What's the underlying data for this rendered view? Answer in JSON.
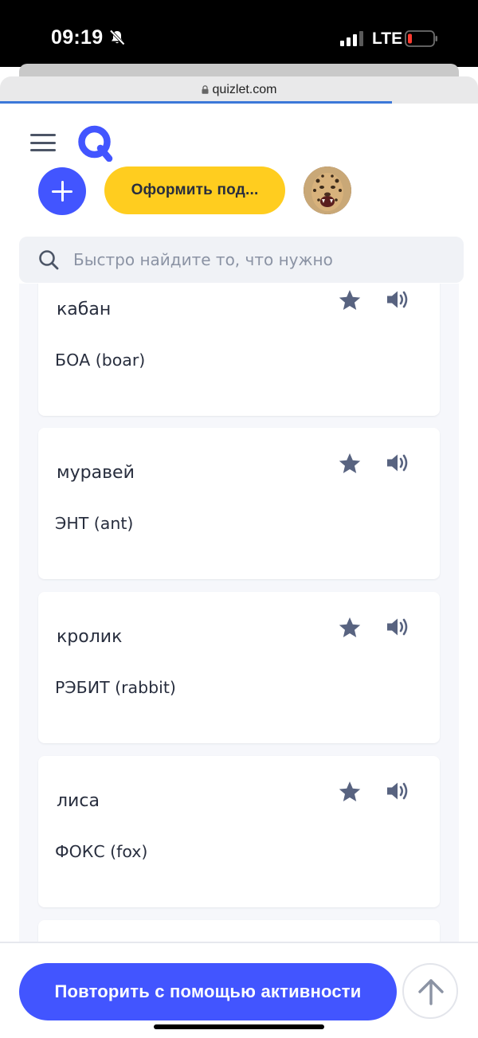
{
  "status_bar": {
    "time": "09:19",
    "network": "LTE",
    "icons": [
      "bell-slash-icon",
      "signal-icon",
      "battery-low-icon"
    ]
  },
  "browser": {
    "url": "quizlet.com",
    "icons": [
      "lock-icon"
    ],
    "load_progress": 0.82
  },
  "header": {
    "menu_icon": "hamburger-icon",
    "logo_icon": "quizlet-logo",
    "add_icon": "plus-icon",
    "upgrade_label": "Оформить под...",
    "avatar": "leopard-avatar"
  },
  "search": {
    "placeholder": "Быстро найдите то, что нужно",
    "icon": "search-icon"
  },
  "cards": [
    {
      "term": "кабан",
      "definition": "БОА (boar)"
    },
    {
      "term": "муравей",
      "definition": "ЭНТ (ant)"
    },
    {
      "term": "кролик",
      "definition": "РЭБИТ (rabbit)"
    },
    {
      "term": "лиса",
      "definition": "ФОКС (fox)"
    }
  ],
  "bottom": {
    "practice_label": "Повторить с помощью активности",
    "scroll_top_icon": "arrow-up-icon"
  },
  "colors": {
    "brand_blue": "#4255ff",
    "upgrade_yellow": "#ffcd1f",
    "icon_gray": "#586380",
    "text_dark": "#282e3e",
    "list_background": "#f6f7fb"
  }
}
